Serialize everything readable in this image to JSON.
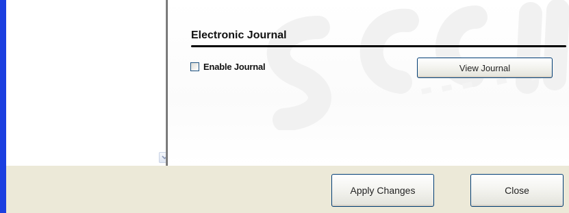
{
  "journal": {
    "title": "Electronic Journal",
    "enable_label": "Enable Journal",
    "enable_checked": false,
    "view_button": "View Journal"
  },
  "footer": {
    "apply_button": "Apply Changes",
    "close_button": "Close"
  },
  "colors": {
    "accent_bar": "#1b3fe0",
    "footer_bg": "#ece9d8",
    "button_border": "#003c74"
  },
  "icons": {
    "scroll_down": "chevron-down-icon"
  }
}
